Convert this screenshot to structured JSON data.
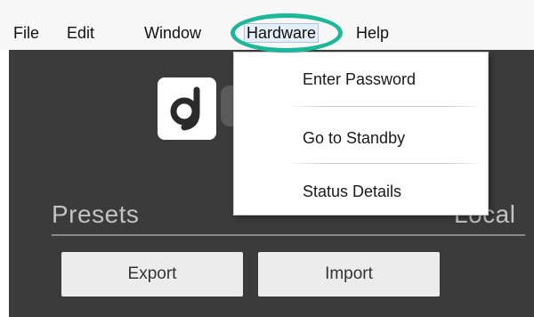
{
  "menubar": {
    "items": [
      {
        "label": "File"
      },
      {
        "label": "Edit"
      },
      {
        "label": "Window"
      },
      {
        "label": "Hardware"
      },
      {
        "label": "Help"
      }
    ],
    "active_item": "Hardware",
    "highlight_color": "#1db89a"
  },
  "dropdown": {
    "items": [
      {
        "label": "Enter Password"
      },
      {
        "label": "Go to Standby"
      },
      {
        "label": "Status Details"
      }
    ]
  },
  "app": {
    "background_color": "#3b3b3b",
    "logo_icon": "app-logo-icon",
    "presets_label": "Presets",
    "local_label": "Local",
    "buttons": {
      "export_label": "Export",
      "import_label": "Import"
    }
  }
}
